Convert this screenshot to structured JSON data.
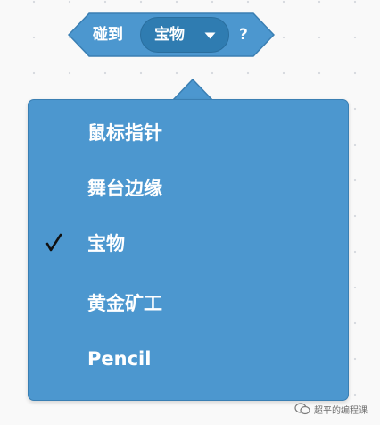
{
  "block": {
    "label": "碰到",
    "dropdown_value": "宝物",
    "question_mark": "?",
    "color": "#4c97cf",
    "dropdown_color": "#2f7cb1"
  },
  "menu": {
    "items": [
      {
        "label": "鼠标指针",
        "checked": false
      },
      {
        "label": "舞台边缘",
        "checked": false
      },
      {
        "label": "宝物",
        "checked": true
      },
      {
        "label": "黄金矿工",
        "checked": false
      },
      {
        "label": "Pencil",
        "checked": false
      }
    ],
    "check_icon": "checkmark-icon",
    "background_color": "#4c97cf"
  },
  "watermark": {
    "text": "超平的编程课",
    "icon": "wechat-icon"
  }
}
